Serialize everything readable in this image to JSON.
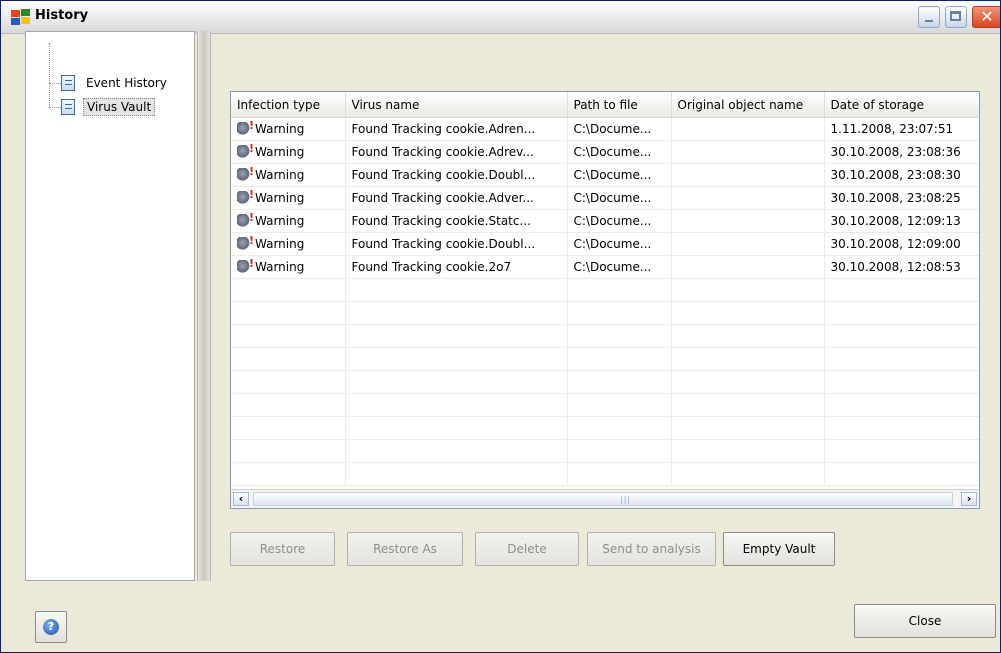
{
  "window": {
    "title": "History"
  },
  "tree": {
    "items": [
      {
        "label": "Event History"
      },
      {
        "label": "Virus Vault"
      }
    ]
  },
  "table": {
    "columns": [
      "Infection type",
      "Virus name",
      "Path to file",
      "Original object name",
      "Date of storage"
    ],
    "rows": [
      [
        "Warning",
        "Found Tracking cookie.Adren...",
        "C:\\Docume...",
        "",
        "1.11.2008, 23:07:51"
      ],
      [
        "Warning",
        "Found Tracking cookie.Adrev...",
        "C:\\Docume...",
        "",
        "30.10.2008, 23:08:36"
      ],
      [
        "Warning",
        "Found Tracking cookie.Doubl...",
        "C:\\Docume...",
        "",
        "30.10.2008, 23:08:30"
      ],
      [
        "Warning",
        "Found Tracking cookie.Adver...",
        "C:\\Docume...",
        "",
        "30.10.2008, 23:08:25"
      ],
      [
        "Warning",
        "Found Tracking cookie.Statc...",
        "C:\\Docume...",
        "",
        "30.10.2008, 12:09:13"
      ],
      [
        "Warning",
        "Found Tracking cookie.Doubl...",
        "C:\\Docume...",
        "",
        "30.10.2008, 12:09:00"
      ],
      [
        "Warning",
        "Found Tracking cookie.2o7",
        "C:\\Docume...",
        "",
        "30.10.2008, 12:08:53"
      ]
    ]
  },
  "actions": {
    "restore": "Restore",
    "restore_as": "Restore As",
    "delete": "Delete",
    "send_to_analysis": "Send to analysis",
    "empty_vault": "Empty Vault"
  },
  "footer": {
    "close": "Close",
    "help_glyph": "?"
  },
  "icons": {
    "row_icon": "warning-icon",
    "window_icon": "avg-logo-icon"
  }
}
